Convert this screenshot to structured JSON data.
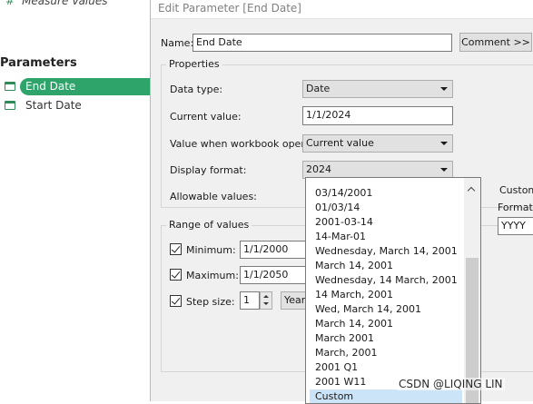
{
  "left_pane": {
    "measure_values": "Measure Values",
    "parameters_heading": "Parameters",
    "parameters": [
      {
        "label": "End Date",
        "active": true
      },
      {
        "label": "Start Date",
        "active": false
      }
    ]
  },
  "dialog": {
    "title": "Edit Parameter [End Date]",
    "name_label": "Name:",
    "name_value": "End Date",
    "comment_button": "Comment >>",
    "properties_title": "Properties",
    "data_type_label": "Data type:",
    "data_type_value": "Date",
    "current_value_label": "Current value:",
    "current_value": "1/1/2024",
    "workbook_opens_label": "Value when workbook opens:",
    "workbook_opens_value": "Current value",
    "display_format_label": "Display format:",
    "display_format_value": "2024",
    "allowable_values_label": "Allowable values:",
    "range_title": "Range of values",
    "minimum_label": "Minimum:",
    "minimum_value": "1/1/2000",
    "maximum_label": "Maximum:",
    "maximum_value": "1/1/2050",
    "step_label": "Step size:",
    "step_value": "1",
    "step_unit": "Years",
    "custom_title": "Custom",
    "format_label": "Format:",
    "format_value": "YYYY"
  },
  "dropdown_options": [
    "03/14/2001",
    "01/03/14",
    "2001-03-14",
    "14-Mar-01",
    "Wednesday, March 14, 2001",
    "March 14, 2001",
    "Wednesday, 14 March, 2001",
    "14 March, 2001",
    "Wed, March 14, 2001",
    "March 14, 2001",
    "March 2001",
    "March, 2001",
    "2001 Q1",
    "2001 W11",
    "Custom"
  ],
  "selected_option": "Custom",
  "watermark": "CSDN @LIQING LIN",
  "colors": {
    "active_param": "#2ea36a",
    "selection": "#cce4f7",
    "dialog_bg": "#f0f0f0"
  },
  "icons": [
    "measure-values-icon",
    "parameter-icon",
    "checkbox-checked-icon",
    "dropdown-arrow-icon",
    "scroll-up-icon",
    "spin-up-icon",
    "spin-down-icon"
  ]
}
